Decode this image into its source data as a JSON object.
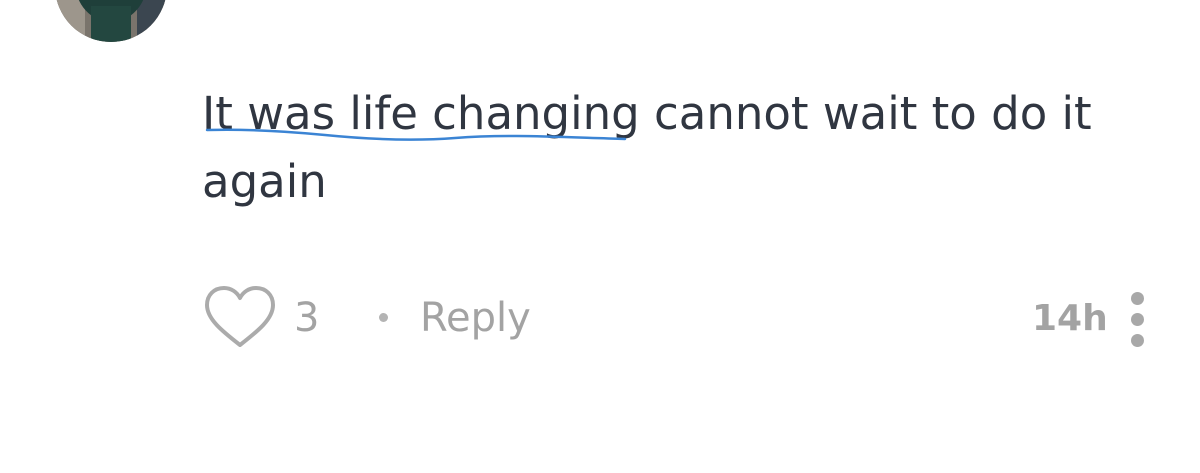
{
  "comment": {
    "text": "It was life changing cannot wait to do it again",
    "likes": "3",
    "reply_label": "Reply",
    "timestamp": "14h"
  },
  "icons": {
    "like": "heart-outline-icon",
    "more": "more-vertical-icon"
  },
  "colors": {
    "text": "#303641",
    "muted": "#a3a3a3",
    "spellcheck_underline": "#3b84d4"
  }
}
